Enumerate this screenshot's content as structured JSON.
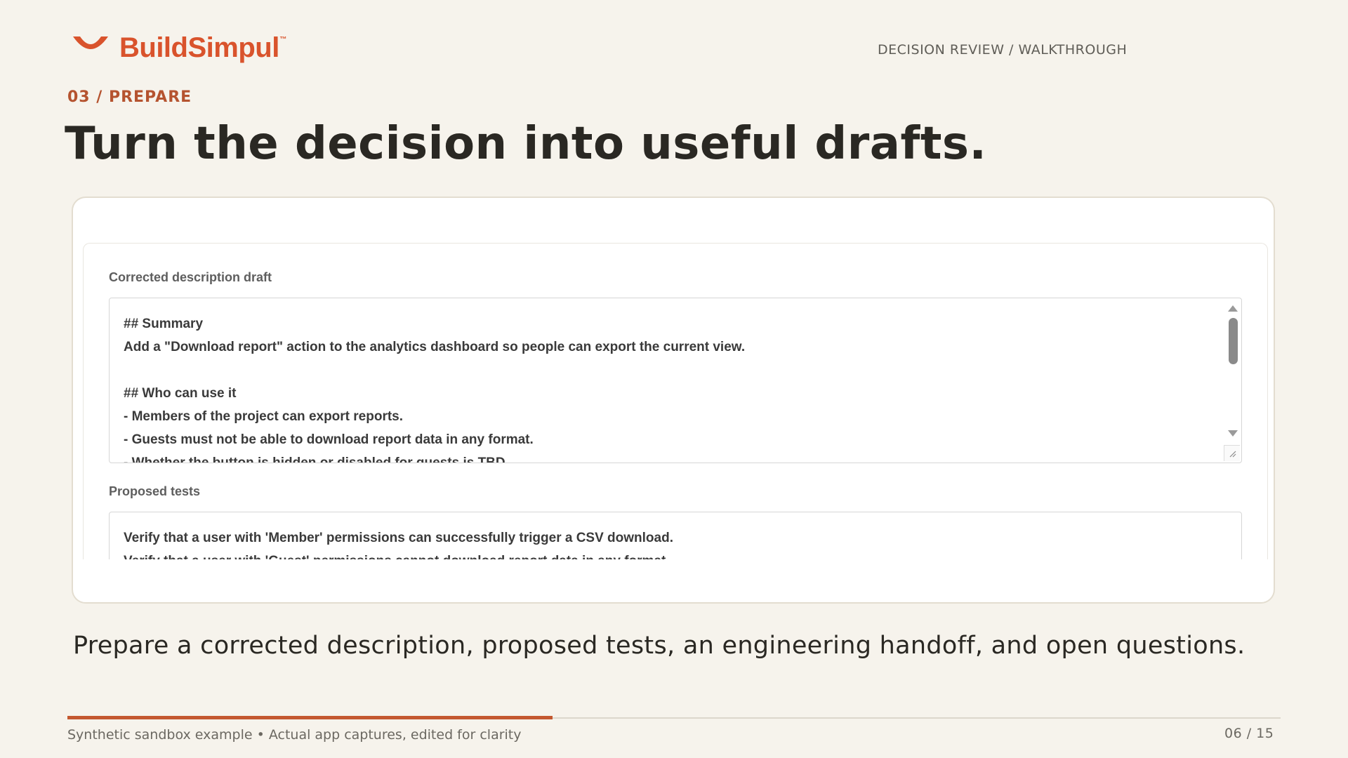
{
  "header": {
    "logo_text": "BuildSimpul",
    "logo_tm": "™",
    "right_label": "DECISION REVIEW / WALKTHROUGH"
  },
  "section": {
    "label": "03 / PREPARE",
    "title": "Turn the decision into useful drafts."
  },
  "app_capture": {
    "description_field": {
      "label": "Corrected description draft",
      "lines": [
        "## Summary",
        "Add a \"Download report\" action to the analytics dashboard so people can export the current view.",
        "",
        "## Who can use it",
        "- Members of the project can export reports.",
        "- Guests must not be able to download report data in any format.",
        "- Whether the button is hidden or disabled for guests is TBD."
      ]
    },
    "tests_field": {
      "label": "Proposed tests",
      "lines": [
        "Verify that a user with 'Member' permissions can successfully trigger a CSV download.",
        "Verify that a user with 'Guest' permissions cannot download report data in any format."
      ]
    }
  },
  "caption": "Prepare a corrected description, proposed tests, an engineering handoff, and open questions.",
  "footer": {
    "left": "Synthetic sandbox example • Actual app captures, edited for clarity",
    "page": "06 / 15",
    "progress": 0.4
  },
  "colors": {
    "accent": "#d9532c",
    "section_label": "#b5532f",
    "progress": "#c4582f",
    "background": "#f6f3ec"
  },
  "icons": {
    "logo": "smile-arc-icon",
    "scroll_up": "triangle-up-icon",
    "scroll_down": "triangle-down-icon",
    "resize": "resize-grip-icon"
  }
}
